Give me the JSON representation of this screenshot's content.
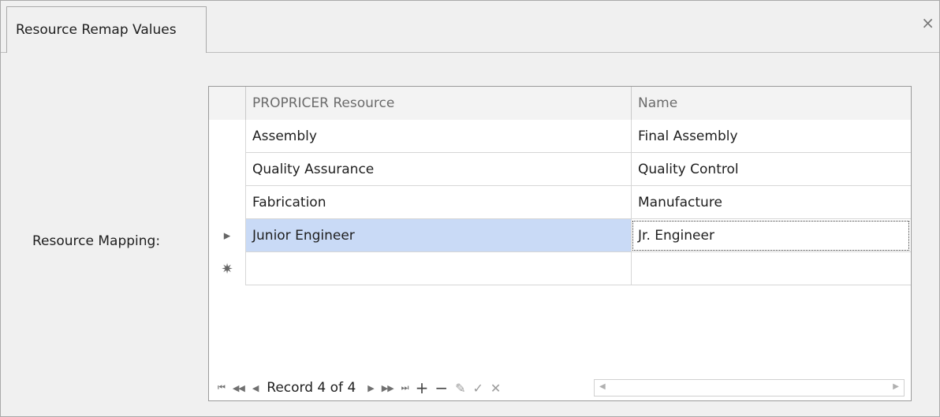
{
  "tab": {
    "title": "Resource Remap Values"
  },
  "window": {
    "close_glyph": "×"
  },
  "form": {
    "mapping_label": "Resource Mapping:"
  },
  "grid": {
    "columns": [
      "PROPRICER Resource",
      "Name"
    ],
    "rows": [
      {
        "resource": "Assembly",
        "name": "Final Assembly"
      },
      {
        "resource": "Quality Assurance",
        "name": "Quality Control"
      },
      {
        "resource": "Fabrication",
        "name": "Manufacture"
      },
      {
        "resource": "Junior Engineer",
        "name": "Jr. Engineer"
      }
    ],
    "current_row_indicator": "▸",
    "new_row_indicator": "✷"
  },
  "navigator": {
    "first": "⏮",
    "prev_page": "◀◀",
    "prev": "◀",
    "record_text": "Record 4 of 4",
    "next": "▶",
    "next_page": "▶▶",
    "last": "⏭",
    "append": "+",
    "remove": "−",
    "edit": "✎",
    "end_edit": "✓",
    "cancel_edit": "✕",
    "scroll_left": "◀",
    "scroll_right": "▶"
  },
  "colors": {
    "selection": "#c9daf6",
    "new_row_star": "#f7931d",
    "window_bg": "#f0f0f0"
  }
}
